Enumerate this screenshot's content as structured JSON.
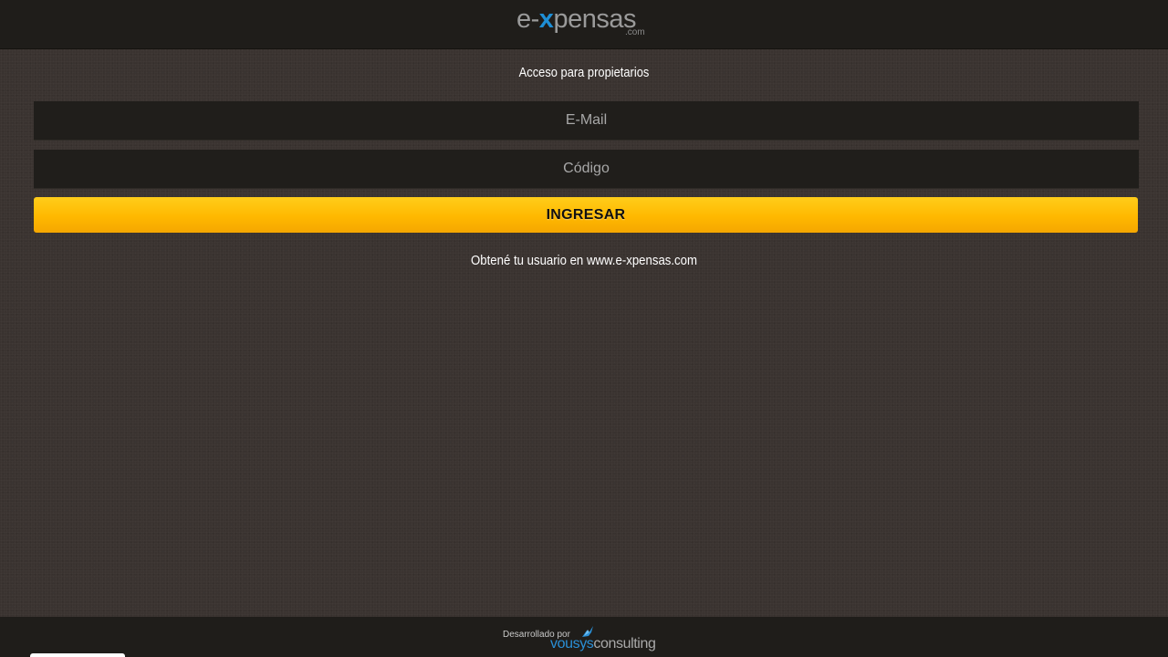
{
  "header": {
    "logo": {
      "prefix": "e-",
      "accent": "x",
      "suffix": "pensas",
      "tld": ".com",
      "accent_color": "#1e8fd6"
    }
  },
  "login": {
    "title": "Acceso para propietarios",
    "email_placeholder": "E-Mail",
    "code_placeholder": "Código",
    "submit_label": "INGRESAR",
    "hint_text": "Obtené tu usuario en ",
    "hint_link": "www.e-xpensas.com"
  },
  "footer": {
    "developed_by": "Desarrollado por",
    "brand_part1": "vousys",
    "brand_part2": "consulting",
    "brand_color": "#2a8fd6"
  },
  "colors": {
    "button": "#ffb800",
    "background": "#3a3330",
    "bars": "#1f1d1a"
  }
}
